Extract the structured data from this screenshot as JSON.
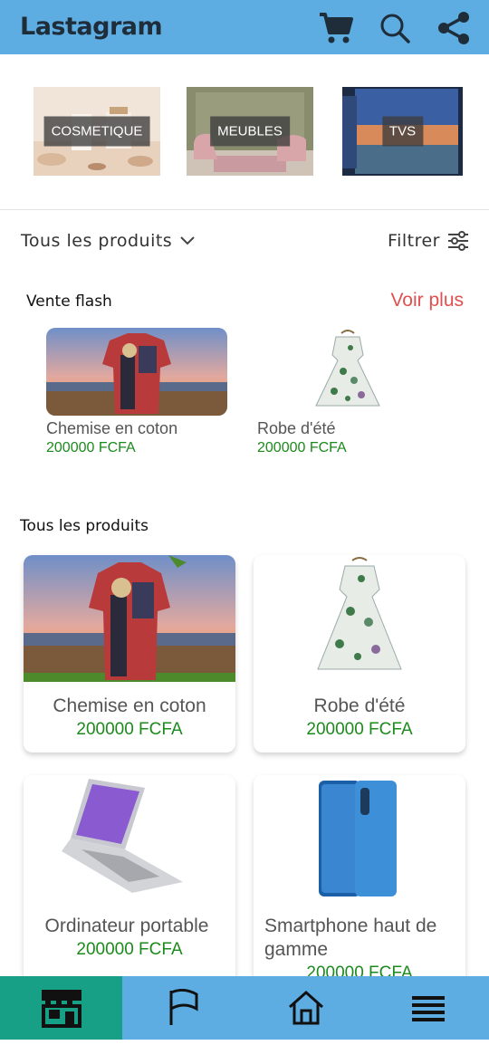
{
  "header": {
    "title": "Lastagram",
    "icons": [
      "cart-icon",
      "search-icon",
      "share-icon"
    ]
  },
  "categories": [
    {
      "label": "COSMETIQUE"
    },
    {
      "label": "MEUBLES"
    },
    {
      "label": "TVS"
    }
  ],
  "filter_bar": {
    "all_products_label": "Tous les produits",
    "filter_label": "Filtrer"
  },
  "flash_sale": {
    "title": "Vente flash",
    "see_more": "Voir plus",
    "items": [
      {
        "name": "Chemise en coton",
        "price": "200000 FCFA"
      },
      {
        "name": "Robe d'été",
        "price": "200000 FCFA"
      }
    ]
  },
  "all_products": {
    "title": "Tous les produits",
    "items": [
      {
        "name": "Chemise en coton",
        "price": "200000 FCFA"
      },
      {
        "name": "Robe d'été",
        "price": "200000 FCFA"
      },
      {
        "name": "Ordinateur portable",
        "price": "200000 FCFA"
      },
      {
        "name": "Smartphone haut de gamme",
        "price": "200000 FCFA"
      }
    ]
  },
  "bottom_nav": {
    "items": [
      "store-icon",
      "flag-icon",
      "home-icon",
      "menu-icon"
    ],
    "active": "store-icon"
  },
  "colors": {
    "primary": "#5dade2",
    "active_nav": "#17a085",
    "price": "#1c8a1c",
    "see_more": "#e05050"
  }
}
